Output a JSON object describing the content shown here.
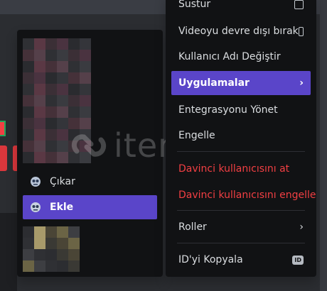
{
  "main_menu": {
    "items": [
      {
        "label": "Sustur",
        "kind": "checkbox"
      },
      {
        "label": "Videoyu devre dışı bırak",
        "kind": "checkbox"
      },
      {
        "label": "Kullanıcı Adı Değiştir",
        "kind": "plain"
      },
      {
        "label": "Uygulamalar",
        "kind": "submenu",
        "active": true
      },
      {
        "label": "Entegrasyonu Yönet",
        "kind": "plain"
      },
      {
        "label": "Engelle",
        "kind": "plain"
      },
      {
        "label": "Davinci kullanıcısını at",
        "kind": "danger"
      },
      {
        "label": "Davinci kullanıcısını engelle",
        "kind": "danger"
      },
      {
        "label": "Roller",
        "kind": "submenu"
      },
      {
        "label": "ID'yi Kopyala",
        "kind": "id"
      }
    ],
    "id_badge": "ID"
  },
  "apps_submenu": {
    "items": [
      {
        "label": "Çıkar",
        "icon": "bot-icon"
      },
      {
        "label": "Ekle",
        "icon": "bot-icon",
        "active": true
      }
    ]
  },
  "watermark": {
    "text": "itemsatis"
  },
  "colors": {
    "accent": "#5a45c9",
    "danger": "#f23f43",
    "menu_bg": "#111214",
    "text": "#dbdee1"
  }
}
